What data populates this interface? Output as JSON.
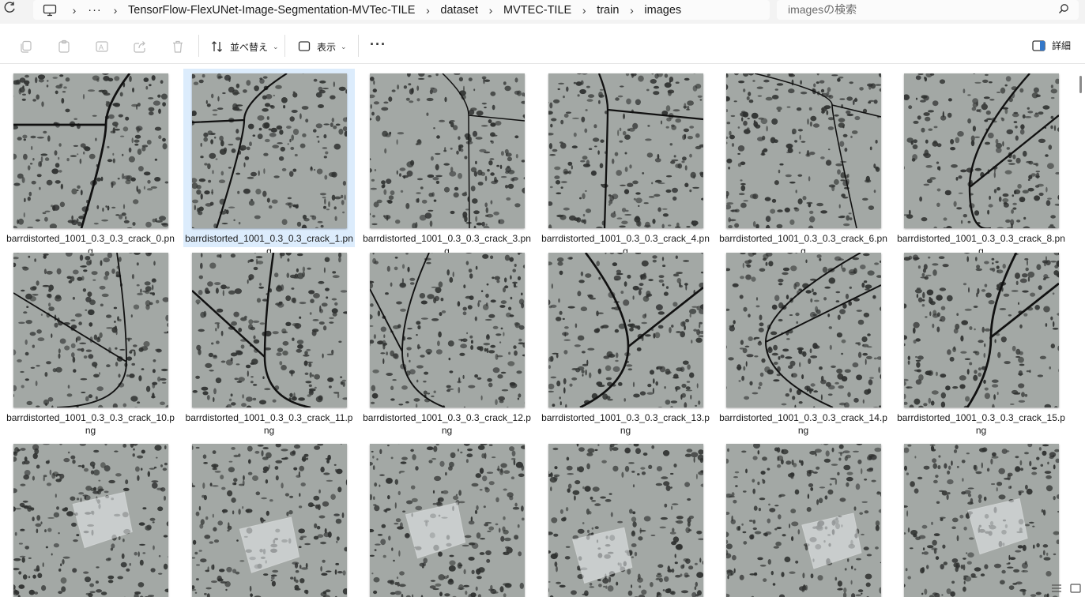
{
  "address_bar": {
    "crumbs": [
      "TensorFlow-FlexUNet-Image-Segmentation-MVTec-TILE",
      "dataset",
      "MVTEC-TILE",
      "train",
      "images"
    ],
    "ellipsis": "···",
    "search_placeholder": "imagesの検索"
  },
  "toolbar": {
    "sort_label": "並べ替え",
    "view_label": "表示",
    "more_label": "···",
    "details_label": "詳細"
  },
  "files": [
    {
      "name": "barrdistorted_1001_0.3_0.3_crack_0.png",
      "selected": false,
      "kind": "crack"
    },
    {
      "name": "barrdistorted_1001_0.3_0.3_crack_1.png",
      "selected": true,
      "kind": "crack"
    },
    {
      "name": "barrdistorted_1001_0.3_0.3_crack_3.png",
      "selected": false,
      "kind": "crack"
    },
    {
      "name": "barrdistorted_1001_0.3_0.3_crack_4.png",
      "selected": false,
      "kind": "crack"
    },
    {
      "name": "barrdistorted_1001_0.3_0.3_crack_6.png",
      "selected": false,
      "kind": "crack"
    },
    {
      "name": "barrdistorted_1001_0.3_0.3_crack_8.png",
      "selected": false,
      "kind": "crack"
    },
    {
      "name": "barrdistorted_1001_0.3_0.3_crack_10.png",
      "selected": false,
      "kind": "crack"
    },
    {
      "name": "barrdistorted_1001_0.3_0.3_crack_11.png",
      "selected": false,
      "kind": "crack"
    },
    {
      "name": "barrdistorted_1001_0.3_0.3_crack_12.png",
      "selected": false,
      "kind": "crack"
    },
    {
      "name": "barrdistorted_1001_0.3_0.3_crack_13.png",
      "selected": false,
      "kind": "crack"
    },
    {
      "name": "barrdistorted_1001_0.3_0.3_crack_14.png",
      "selected": false,
      "kind": "crack"
    },
    {
      "name": "barrdistorted_1001_0.3_0.3_crack_15.png",
      "selected": false,
      "kind": "crack"
    },
    {
      "name": "",
      "selected": false,
      "kind": "tape"
    },
    {
      "name": "",
      "selected": false,
      "kind": "tape"
    },
    {
      "name": "",
      "selected": false,
      "kind": "tape"
    },
    {
      "name": "",
      "selected": false,
      "kind": "tape"
    },
    {
      "name": "",
      "selected": false,
      "kind": "tape"
    },
    {
      "name": "",
      "selected": false,
      "kind": "tape"
    }
  ],
  "colors": {
    "selection": "#dcecfc",
    "tile_base": "#a3a8a5",
    "tile_spot": "#2e302f"
  }
}
